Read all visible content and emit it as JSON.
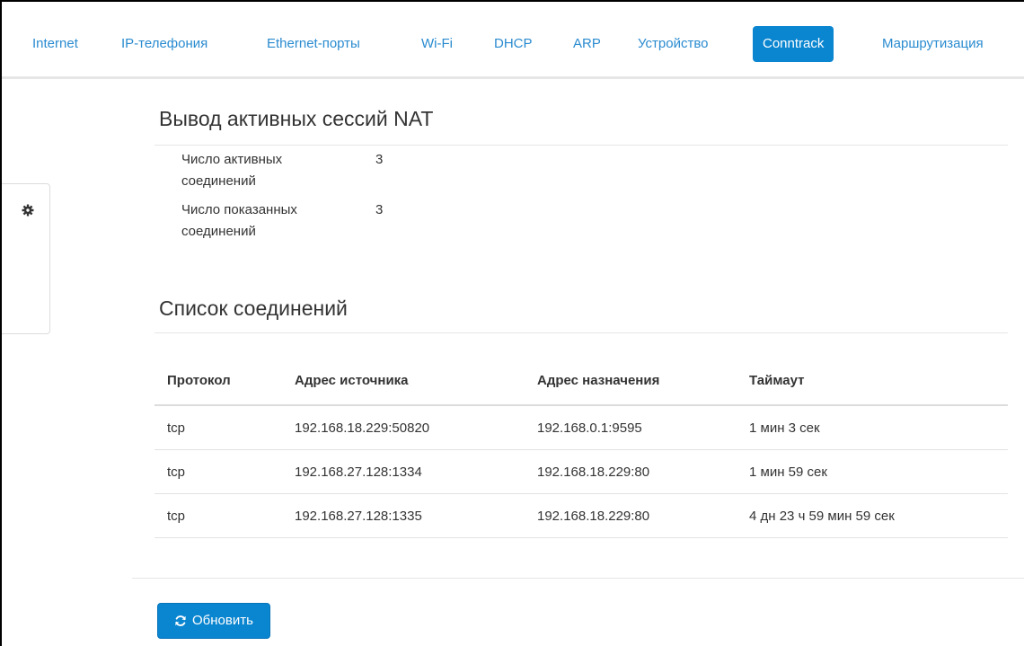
{
  "nav": {
    "items": [
      {
        "label": "Internet"
      },
      {
        "label": "IP-телефония"
      },
      {
        "label": "Ethernet-порты"
      },
      {
        "label": "Wi-Fi"
      },
      {
        "label": "DHCP"
      },
      {
        "label": "ARP"
      },
      {
        "label": "Устройство"
      },
      {
        "label": "Conntrack",
        "active": true
      },
      {
        "label": "Маршрутизация"
      }
    ]
  },
  "section_nat": {
    "title": "Вывод активных сессий NAT",
    "active_connections_label_line1": "Число активных",
    "active_connections_label_line2": "соединений",
    "active_connections_value": "3",
    "shown_connections_label_line1": "Число показанных",
    "shown_connections_label_line2": "соединений",
    "shown_connections_value": "3"
  },
  "section_list": {
    "title": "Список соединений",
    "columns": [
      "Протокол",
      "Адрес источника",
      "Адрес назначения",
      "Таймаут"
    ],
    "rows": [
      [
        "tcp",
        "192.168.18.229:50820",
        "192.168.0.1:9595",
        "1 мин 3 сек"
      ],
      [
        "tcp",
        "192.168.27.128:1334",
        "192.168.18.229:80",
        "1 мин 59 сек"
      ],
      [
        "tcp",
        "192.168.27.128:1335",
        "192.168.18.229:80",
        "4 дн 23 ч 59 мин 59 сек"
      ]
    ]
  },
  "actions": {
    "refresh_label": "Обновить",
    "refresh_icon": "refresh-icon"
  },
  "sidebar": {
    "toggle_icon": "gear-icon"
  },
  "colors": {
    "accent": "#0a85d0",
    "link": "#2a8bd0"
  }
}
